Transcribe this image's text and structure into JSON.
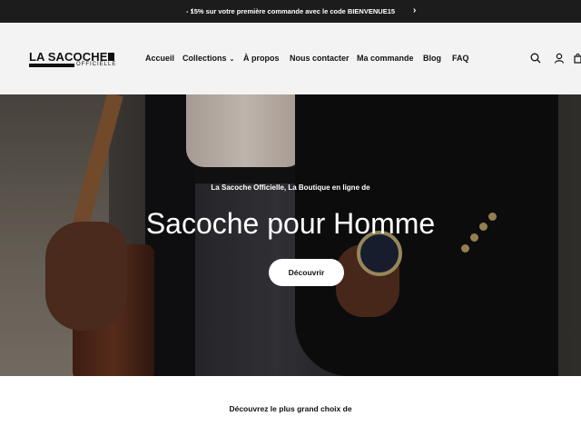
{
  "announcement": {
    "prev_icon": "chevron-left-icon",
    "next_icon": "chevron-right-icon",
    "text": "- 15% sur votre première commande avec le code BIENVENUE15"
  },
  "header": {
    "logo": {
      "brand": "LA SACOCHE",
      "sub": "OFFICIELLE"
    },
    "nav": [
      {
        "label": "Accueil"
      },
      {
        "label": "Collections",
        "has_dropdown": true
      },
      {
        "label": "À propos"
      },
      {
        "label": "Nous contacter"
      },
      {
        "label": "Ma commande"
      },
      {
        "label": "Blog"
      },
      {
        "label": "FAQ"
      }
    ],
    "icons": [
      "search-icon",
      "account-icon",
      "cart-icon"
    ]
  },
  "hero": {
    "kicker": "La Sacoche Officielle, La Boutique en ligne de",
    "title": "Sacoche pour Homme",
    "cta": "Découvrir"
  },
  "section": {
    "intro": "Découvrez le plus grand choix de"
  },
  "colors": {
    "announcement_bg": "#1c1c1c",
    "header_bg": "#f3f3f3",
    "button_bg": "#ffffff",
    "text": "#111111"
  }
}
